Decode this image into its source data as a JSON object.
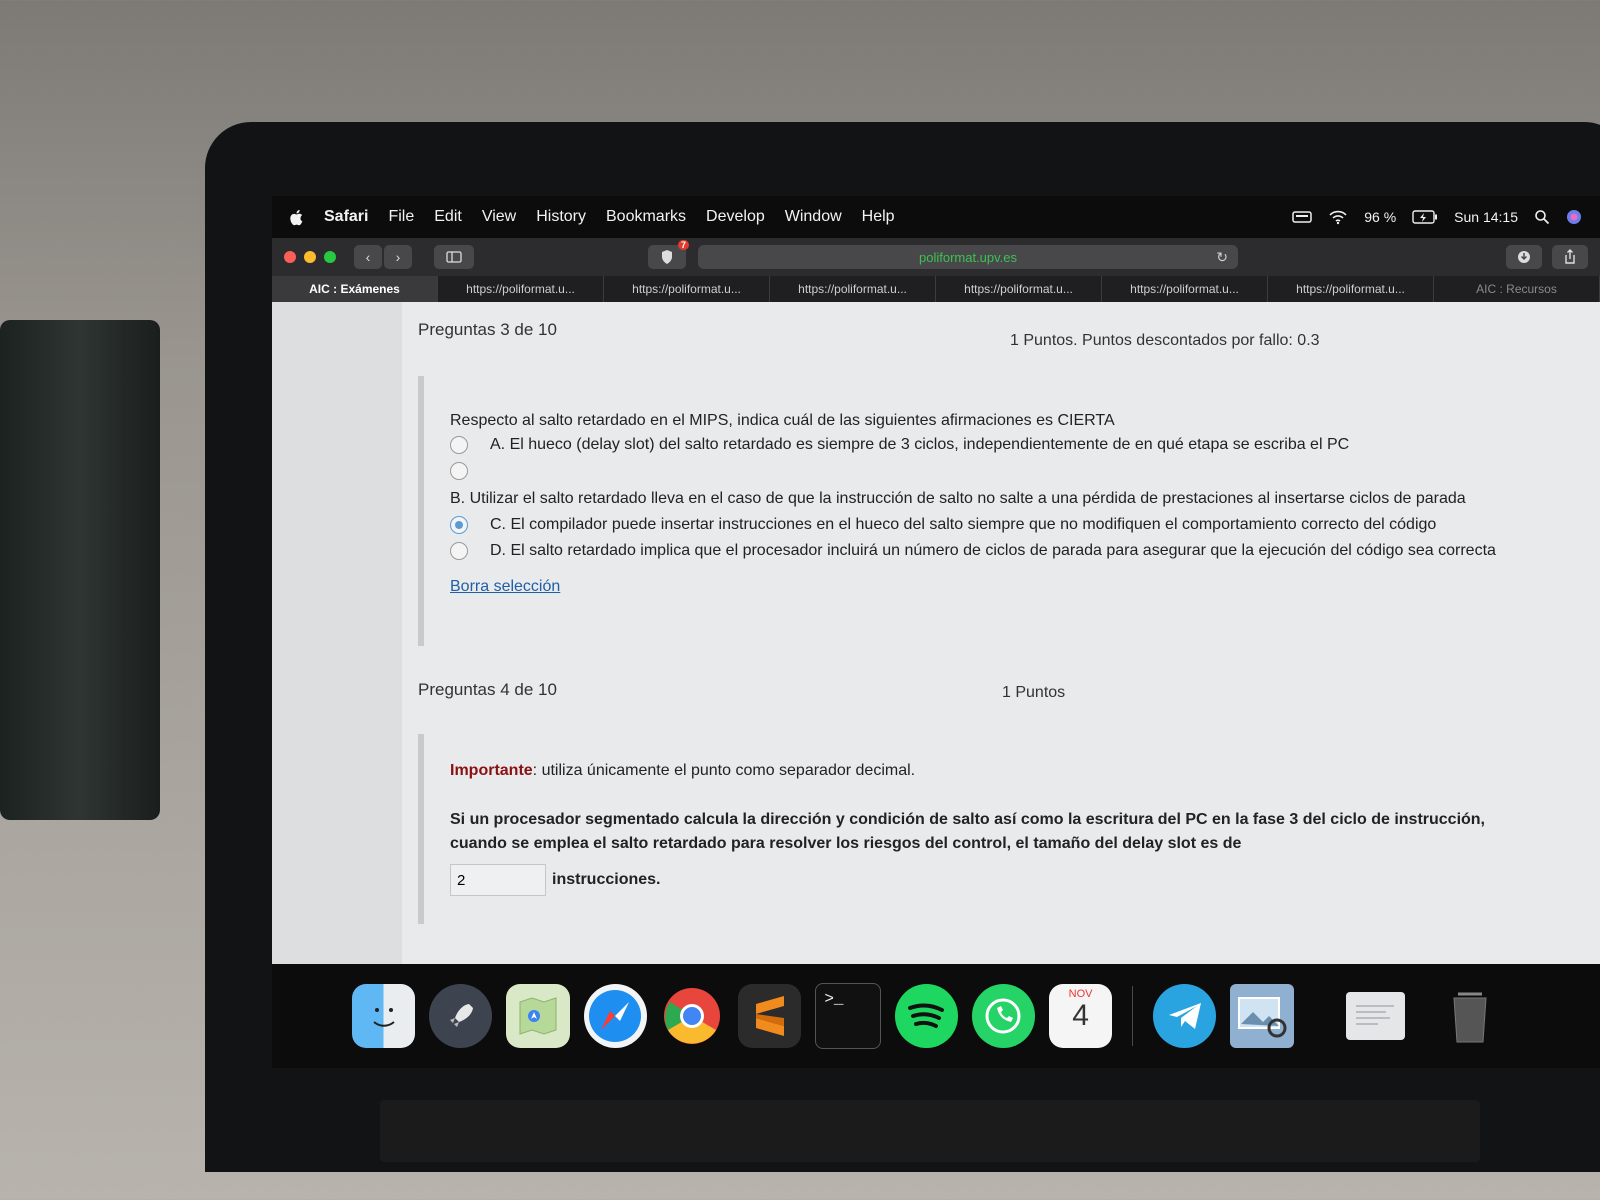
{
  "menubar": {
    "items": [
      "Safari",
      "File",
      "Edit",
      "View",
      "History",
      "Bookmarks",
      "Develop",
      "Window",
      "Help"
    ],
    "battery": "96 %",
    "clock": "Sun 14:15"
  },
  "toolbar": {
    "shield_badge": "7",
    "url": "poliformat.upv.es"
  },
  "tabs": [
    "AIC : Exámenes",
    "https://poliformat.u...",
    "https://poliformat.u...",
    "https://poliformat.u...",
    "https://poliformat.u...",
    "https://poliformat.u...",
    "https://poliformat.u...",
    "AIC : Recursos"
  ],
  "q3": {
    "header": "Preguntas 3 de 10",
    "points": "1 Puntos. Puntos descontados por fallo: 0.3",
    "text": "Respecto al salto retardado en el MIPS, indica cuál de las siguientes afirmaciones es CIERTA",
    "option_a": "A. El hueco (delay slot) del salto retardado es siempre de 3 ciclos, independientemente de en qué etapa se escriba el PC",
    "option_b": "B. Utilizar el salto retardado lleva en el caso de que la instrucción de salto no salte a una pérdida de prestaciones al insertarse ciclos de parada",
    "option_c": "C. El compilador puede insertar instrucciones en el hueco del salto siempre que no modifiquen el comportamiento correcto del código",
    "option_d": "D. El salto retardado implica que el procesador incluirá un número de ciclos de parada para asegurar que la ejecución del código sea correcta",
    "clear_link": "Borra selección"
  },
  "q4": {
    "header": "Preguntas 4 de 10",
    "points": "1 Puntos",
    "important_label": "Importante",
    "important_text": ": utiliza únicamente el punto como separador decimal.",
    "question": "Si un procesador segmentado calcula la dirección y condición de salto así como la escritura del PC en la fase 3 del ciclo de instrucción, cuando se emplea el salto retardado para resolver los riesgos del control, el tamaño del delay slot es de",
    "answer_value": "2",
    "unit": "instrucciones."
  },
  "dock": {
    "calendar_month": "NOV",
    "calendar_day": "4"
  }
}
